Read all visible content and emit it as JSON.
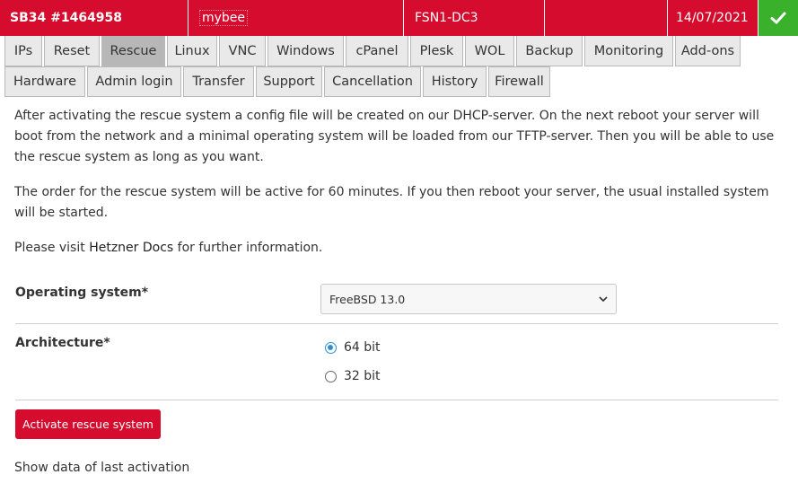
{
  "header": {
    "server": "SB34 #1464958",
    "name": "mybee",
    "datacenter": "FSN1-DC3",
    "blank": "",
    "date": "14/07/2021",
    "status_icon": "check-icon",
    "colors": {
      "brand": "#d50c2d",
      "ok": "#39b12a"
    }
  },
  "tabs": {
    "row1": [
      "IPs",
      "Reset",
      "Rescue",
      "Linux",
      "VNC",
      "Windows",
      "cPanel",
      "Plesk",
      "WOL",
      "Backup",
      "Monitoring",
      "Add-ons"
    ],
    "row2": [
      "Hardware",
      "Admin login",
      "Transfer",
      "Support",
      "Cancellation",
      "History",
      "Firewall"
    ],
    "active": "Rescue"
  },
  "content": {
    "para1": "After activating the rescue system a config file will be created on our DHCP-server. On the next reboot your server will boot from the network and a minimal operating system will be loaded from our TFTP-server. Then you will be able to use the rescue system as long as you want.",
    "para2": "The order for the rescue system will be active for 60 minutes. If you then reboot your server, the usual installed system will be started.",
    "para3_prefix": "Please visit ",
    "para3_link": "Hetzner Docs",
    "para3_suffix": " for further information."
  },
  "form": {
    "os_label": "Operating system*",
    "os_value": "FreeBSD 13.0",
    "arch_label": "Architecture*",
    "arch_options": [
      "64 bit",
      "32 bit"
    ],
    "arch_selected": "64 bit",
    "submit_label": "Activate rescue system"
  },
  "footer": {
    "last_activation": "Show data of last activation"
  }
}
